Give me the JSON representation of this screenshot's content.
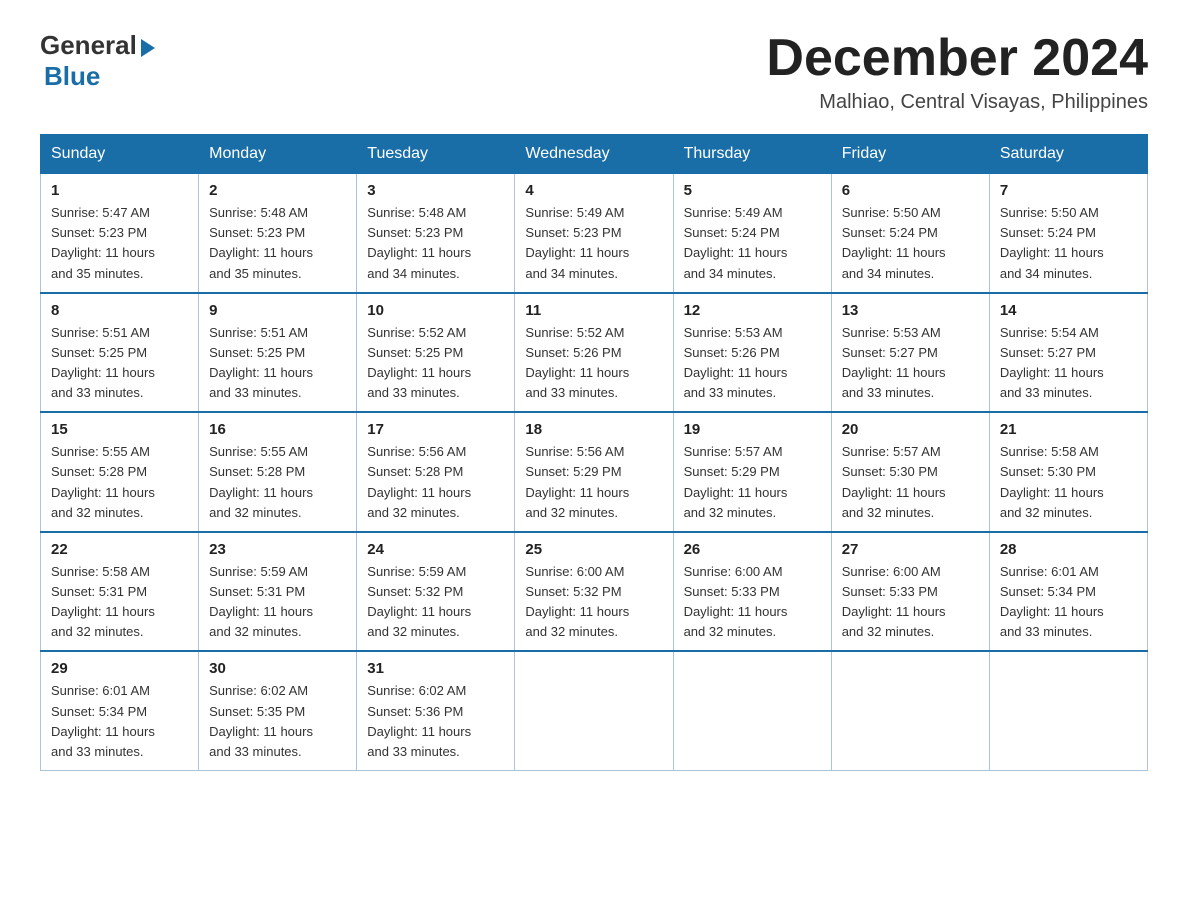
{
  "header": {
    "logo_general": "General",
    "logo_blue": "Blue",
    "month_title": "December 2024",
    "location": "Malhiao, Central Visayas, Philippines"
  },
  "weekdays": [
    "Sunday",
    "Monday",
    "Tuesday",
    "Wednesday",
    "Thursday",
    "Friday",
    "Saturday"
  ],
  "weeks": [
    [
      {
        "day": "1",
        "info": "Sunrise: 5:47 AM\nSunset: 5:23 PM\nDaylight: 11 hours\nand 35 minutes."
      },
      {
        "day": "2",
        "info": "Sunrise: 5:48 AM\nSunset: 5:23 PM\nDaylight: 11 hours\nand 35 minutes."
      },
      {
        "day": "3",
        "info": "Sunrise: 5:48 AM\nSunset: 5:23 PM\nDaylight: 11 hours\nand 34 minutes."
      },
      {
        "day": "4",
        "info": "Sunrise: 5:49 AM\nSunset: 5:23 PM\nDaylight: 11 hours\nand 34 minutes."
      },
      {
        "day": "5",
        "info": "Sunrise: 5:49 AM\nSunset: 5:24 PM\nDaylight: 11 hours\nand 34 minutes."
      },
      {
        "day": "6",
        "info": "Sunrise: 5:50 AM\nSunset: 5:24 PM\nDaylight: 11 hours\nand 34 minutes."
      },
      {
        "day": "7",
        "info": "Sunrise: 5:50 AM\nSunset: 5:24 PM\nDaylight: 11 hours\nand 34 minutes."
      }
    ],
    [
      {
        "day": "8",
        "info": "Sunrise: 5:51 AM\nSunset: 5:25 PM\nDaylight: 11 hours\nand 33 minutes."
      },
      {
        "day": "9",
        "info": "Sunrise: 5:51 AM\nSunset: 5:25 PM\nDaylight: 11 hours\nand 33 minutes."
      },
      {
        "day": "10",
        "info": "Sunrise: 5:52 AM\nSunset: 5:25 PM\nDaylight: 11 hours\nand 33 minutes."
      },
      {
        "day": "11",
        "info": "Sunrise: 5:52 AM\nSunset: 5:26 PM\nDaylight: 11 hours\nand 33 minutes."
      },
      {
        "day": "12",
        "info": "Sunrise: 5:53 AM\nSunset: 5:26 PM\nDaylight: 11 hours\nand 33 minutes."
      },
      {
        "day": "13",
        "info": "Sunrise: 5:53 AM\nSunset: 5:27 PM\nDaylight: 11 hours\nand 33 minutes."
      },
      {
        "day": "14",
        "info": "Sunrise: 5:54 AM\nSunset: 5:27 PM\nDaylight: 11 hours\nand 33 minutes."
      }
    ],
    [
      {
        "day": "15",
        "info": "Sunrise: 5:55 AM\nSunset: 5:28 PM\nDaylight: 11 hours\nand 32 minutes."
      },
      {
        "day": "16",
        "info": "Sunrise: 5:55 AM\nSunset: 5:28 PM\nDaylight: 11 hours\nand 32 minutes."
      },
      {
        "day": "17",
        "info": "Sunrise: 5:56 AM\nSunset: 5:28 PM\nDaylight: 11 hours\nand 32 minutes."
      },
      {
        "day": "18",
        "info": "Sunrise: 5:56 AM\nSunset: 5:29 PM\nDaylight: 11 hours\nand 32 minutes."
      },
      {
        "day": "19",
        "info": "Sunrise: 5:57 AM\nSunset: 5:29 PM\nDaylight: 11 hours\nand 32 minutes."
      },
      {
        "day": "20",
        "info": "Sunrise: 5:57 AM\nSunset: 5:30 PM\nDaylight: 11 hours\nand 32 minutes."
      },
      {
        "day": "21",
        "info": "Sunrise: 5:58 AM\nSunset: 5:30 PM\nDaylight: 11 hours\nand 32 minutes."
      }
    ],
    [
      {
        "day": "22",
        "info": "Sunrise: 5:58 AM\nSunset: 5:31 PM\nDaylight: 11 hours\nand 32 minutes."
      },
      {
        "day": "23",
        "info": "Sunrise: 5:59 AM\nSunset: 5:31 PM\nDaylight: 11 hours\nand 32 minutes."
      },
      {
        "day": "24",
        "info": "Sunrise: 5:59 AM\nSunset: 5:32 PM\nDaylight: 11 hours\nand 32 minutes."
      },
      {
        "day": "25",
        "info": "Sunrise: 6:00 AM\nSunset: 5:32 PM\nDaylight: 11 hours\nand 32 minutes."
      },
      {
        "day": "26",
        "info": "Sunrise: 6:00 AM\nSunset: 5:33 PM\nDaylight: 11 hours\nand 32 minutes."
      },
      {
        "day": "27",
        "info": "Sunrise: 6:00 AM\nSunset: 5:33 PM\nDaylight: 11 hours\nand 32 minutes."
      },
      {
        "day": "28",
        "info": "Sunrise: 6:01 AM\nSunset: 5:34 PM\nDaylight: 11 hours\nand 33 minutes."
      }
    ],
    [
      {
        "day": "29",
        "info": "Sunrise: 6:01 AM\nSunset: 5:34 PM\nDaylight: 11 hours\nand 33 minutes."
      },
      {
        "day": "30",
        "info": "Sunrise: 6:02 AM\nSunset: 5:35 PM\nDaylight: 11 hours\nand 33 minutes."
      },
      {
        "day": "31",
        "info": "Sunrise: 6:02 AM\nSunset: 5:36 PM\nDaylight: 11 hours\nand 33 minutes."
      },
      null,
      null,
      null,
      null
    ]
  ]
}
